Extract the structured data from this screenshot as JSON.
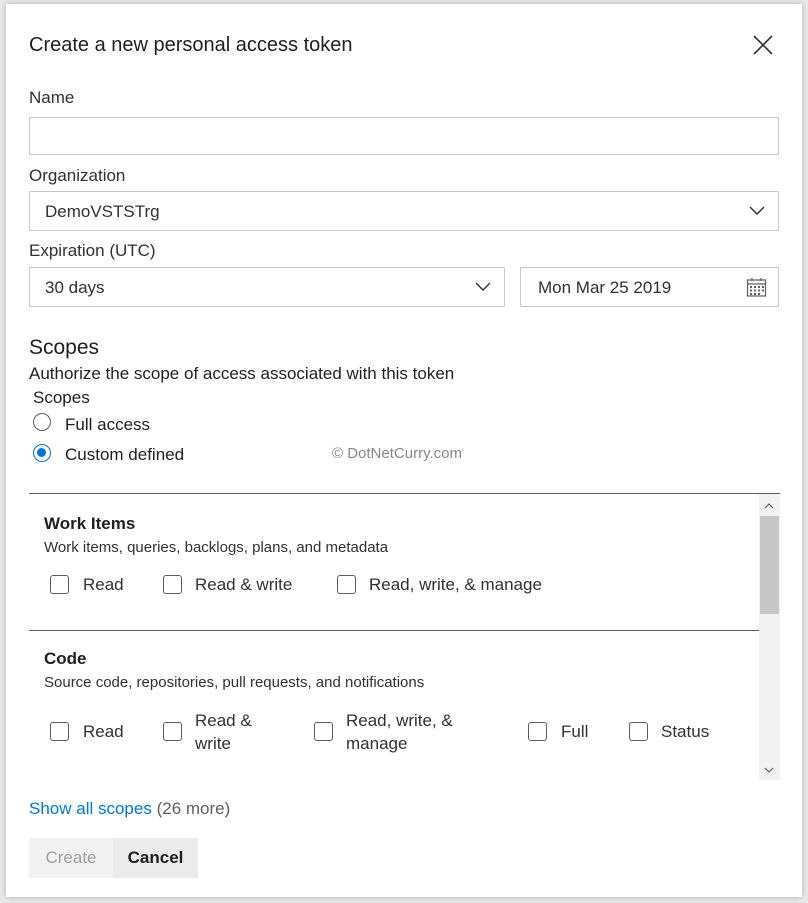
{
  "dialog": {
    "title": "Create a new personal access token",
    "close_icon": "close-icon"
  },
  "form": {
    "name_label": "Name",
    "name_value": "",
    "organization_label": "Organization",
    "organization_value": "DemoVSTSTrg",
    "expiration_label": "Expiration (UTC)",
    "expiration_value": "30 days",
    "expiration_date": "Mon Mar 25 2019"
  },
  "scopes": {
    "heading": "Scopes",
    "description": "Authorize the scope of access associated with this token",
    "group_label": "Scopes",
    "options": [
      {
        "label": "Full access",
        "selected": false
      },
      {
        "label": "Custom defined",
        "selected": true
      }
    ]
  },
  "watermark": "© DotNetCurry.com",
  "scope_sections": [
    {
      "title": "Work Items",
      "description": "Work items, queries, backlogs, plans, and metadata",
      "permissions": [
        "Read",
        "Read & write",
        "Read, write, & manage"
      ]
    },
    {
      "title": "Code",
      "description": "Source code, repositories, pull requests, and notifications",
      "permissions": [
        "Read",
        "Read &",
        "write",
        "Read, write, &",
        "manage",
        "Full",
        "Status"
      ]
    }
  ],
  "footer": {
    "show_all_link": "Show all scopes",
    "more_count": "(26 more)",
    "create_label": "Create",
    "cancel_label": "Cancel"
  },
  "colors": {
    "accent": "#0078d4",
    "border": "#c8c6c4",
    "text": "#201f1e"
  }
}
